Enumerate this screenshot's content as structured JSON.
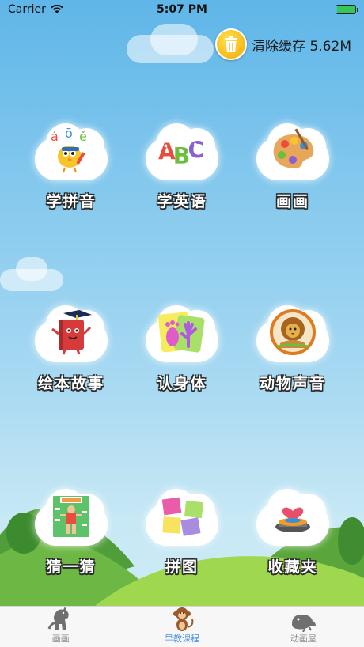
{
  "status_bar": {
    "carrier": "Carrier",
    "time": "5:07 PM"
  },
  "cache": {
    "label": "清除缓存 5.62M",
    "icon": "trash-icon"
  },
  "grid": [
    {
      "label": "学拼音",
      "icon": "pinyin-bird-icon"
    },
    {
      "label": "学英语",
      "icon": "abc-letters-icon"
    },
    {
      "label": "画画",
      "icon": "paint-palette-icon"
    },
    {
      "label": "绘本故事",
      "icon": "storybook-icon"
    },
    {
      "label": "认身体",
      "icon": "hand-foot-icon"
    },
    {
      "label": "动物声音",
      "icon": "lion-icon"
    },
    {
      "label": "猜一猜",
      "icon": "body-chart-icon"
    },
    {
      "label": "拼图",
      "icon": "puzzle-icon"
    },
    {
      "label": "收藏夹",
      "icon": "heart-box-icon"
    }
  ],
  "tabs": [
    {
      "label": "画画",
      "icon": "dinosaur-icon",
      "active": false
    },
    {
      "label": "早教课程",
      "icon": "monkey-icon",
      "active": true
    },
    {
      "label": "动画屋",
      "icon": "seal-icon",
      "active": false
    }
  ],
  "colors": {
    "sky_top": "#5fb6e8",
    "accent_tab": "#4a90e2",
    "trash_yellow": "#f4a800"
  }
}
